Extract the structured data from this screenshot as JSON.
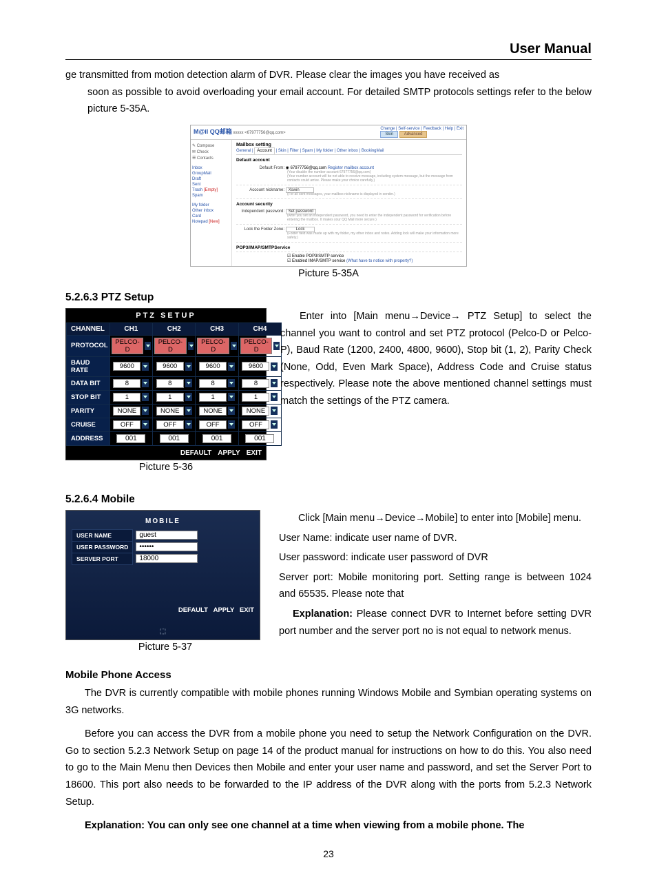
{
  "header": {
    "title": "User Manual"
  },
  "intro": {
    "p1a": "ge transmitted from motion detection alarm of DVR. Please clear the images you have received as",
    "p1b": "soon as possible to avoid overloading your email account. For detailed SMTP protocols settings refer   to the below picture 5-35A."
  },
  "email_shot": {
    "logo": "M@il QQ邮箱",
    "user_info": "xxxxx <67977756@qq.com>",
    "toplinks": "Change | Self-service | Feedback | Help | Exit",
    "btn_left": "Skin",
    "btn_right": "Advanced",
    "side": {
      "compose": "Compose",
      "check": "Check",
      "contacts": "Contacts",
      "inbox": "Inbox",
      "groupmail": "GroupMail",
      "draft": "Draft",
      "sent": "Sent",
      "trash": "Trash",
      "trash_clear": "[Empty]",
      "spam": "Spam",
      "myfolder": "My folder",
      "other": "Other inbox",
      "card": "Card",
      "notepad": "Notepad",
      "notepad_clear": "[New]"
    },
    "main": {
      "setting_title": "Mailbox setting",
      "tabs": [
        "General",
        "Account",
        "Skin",
        "Filter",
        "Spam",
        "My folder",
        "Other inbox",
        "BookingMail"
      ],
      "default_acct_h": "Default account",
      "default_from": "Default From:",
      "default_from_v": "67977756@qq.com",
      "reg_link": "Register mailbox account",
      "note1": "(Your disable the number account 67977756@qq.com)",
      "note2": "(Your number account will be not able to receive message, including system message, but the message from contacts could arrive. Please make your choice carefully.)",
      "nick_lb": "Account nickname:",
      "nick_v": "Xswin",
      "nick_note": "(For all sent messages, your mailbox nickname is displayed in sender.)",
      "sec_h": "Account security",
      "indep_lb": "Independent password:",
      "indep_btn": "Set password",
      "indep_note": "(After you set an independent password, you need to enter the independent password for verification before entering the mailbox. It makes your QQ Mail more secure.)",
      "lock_lb": "Lock the Folder Zone:",
      "lock_btn": "Lock",
      "lock_note": "(Folder field was made up with my folder, my other inbox and notes. Adding lock will make your information more safety.)",
      "pop_h": "POP3/IMAP/SMTPService",
      "pop_cb": "Enable POP3/SMTP service",
      "pop_cb2": "Enabled IMAP/SMTP service",
      "pop_link": "(What have to notice with property?)"
    }
  },
  "caption_535a": "Picture 5-35A",
  "ptz": {
    "heading": "5.2.6.3 PTZ Setup",
    "title": "PTZ  SETUP",
    "rows": [
      "CHANNEL",
      "PROTOCOL",
      "BAUD RATE",
      "DATA BIT",
      "STOP BIT",
      "PARITY",
      "CRUISE",
      "ADDRESS"
    ],
    "cols": [
      "CH1",
      "CH2",
      "CH3",
      "CH4"
    ],
    "protocol": "PELCO-D",
    "baud": "9600",
    "databit": "8",
    "stopbit": "1",
    "parity": "NONE",
    "cruise": "OFF",
    "address": "001",
    "btn_default": "DEFAULT",
    "btn_apply": "APPLY",
    "btn_exit": "EXIT",
    "caption": "Picture 5-36",
    "body": "Enter into [Main menu→Device→ PTZ Setup] to select the channel you want to control and set PTZ protocol (Pelco-D or Pelco-P), Baud Rate (1200, 2400, 4800, 9600), Stop bit (1, 2), Parity Check (None, Odd, Even Mark Space), Address Code and Cruise status respectively. Please note the above mentioned channel settings must match the settings of the PTZ camera."
  },
  "mobile": {
    "heading": "5.2.6.4 Mobile",
    "title": "MOBILE",
    "user_name_lb": "USER   NAME",
    "user_name_v": "guest",
    "user_pass_lb": "USER   PASSWORD",
    "user_pass_v": "••••••",
    "serv_port_lb": "SERVER  PORT",
    "serv_port_v": "18000",
    "btn_default": "DEFAULT",
    "btn_apply": "APPLY",
    "btn_exit": "EXIT",
    "caption": "Picture 5-37",
    "p1": "Click [Main menu→Device→Mobile] to enter into [Mobile] menu.",
    "p2": "User Name: indicate user name of DVR.",
    "p3": "User password: indicate user password of DVR",
    "p4": "Server port: Mobile monitoring port. Setting range is between 1024 and 65535. Please note that",
    "p5a": "Explanation:",
    "p5b": " Please connect DVR to Internet before setting DVR port number and the server port no is not equal to network menus."
  },
  "access": {
    "heading": "Mobile Phone Access",
    "p1": "The DVR is currently compatible with mobile phones running Windows Mobile and Symbian operating systems on 3G networks.",
    "p2": "Before you can access the DVR from a mobile phone you need to setup the Network Configuration on the DVR. Go to section 5.2.3 Network Setup on page 14 of the product manual for instructions on how to do this. You also need to go to the Main Menu then Devices then Mobile and enter your user name and password, and set the Server Port to 18600. This port also needs to be forwarded to the IP address of the DVR along with the ports from 5.2.3 Network Setup.",
    "p3": "Explanation: You can only see one channel at a time when viewing from a mobile phone. The"
  },
  "page_number": "23"
}
